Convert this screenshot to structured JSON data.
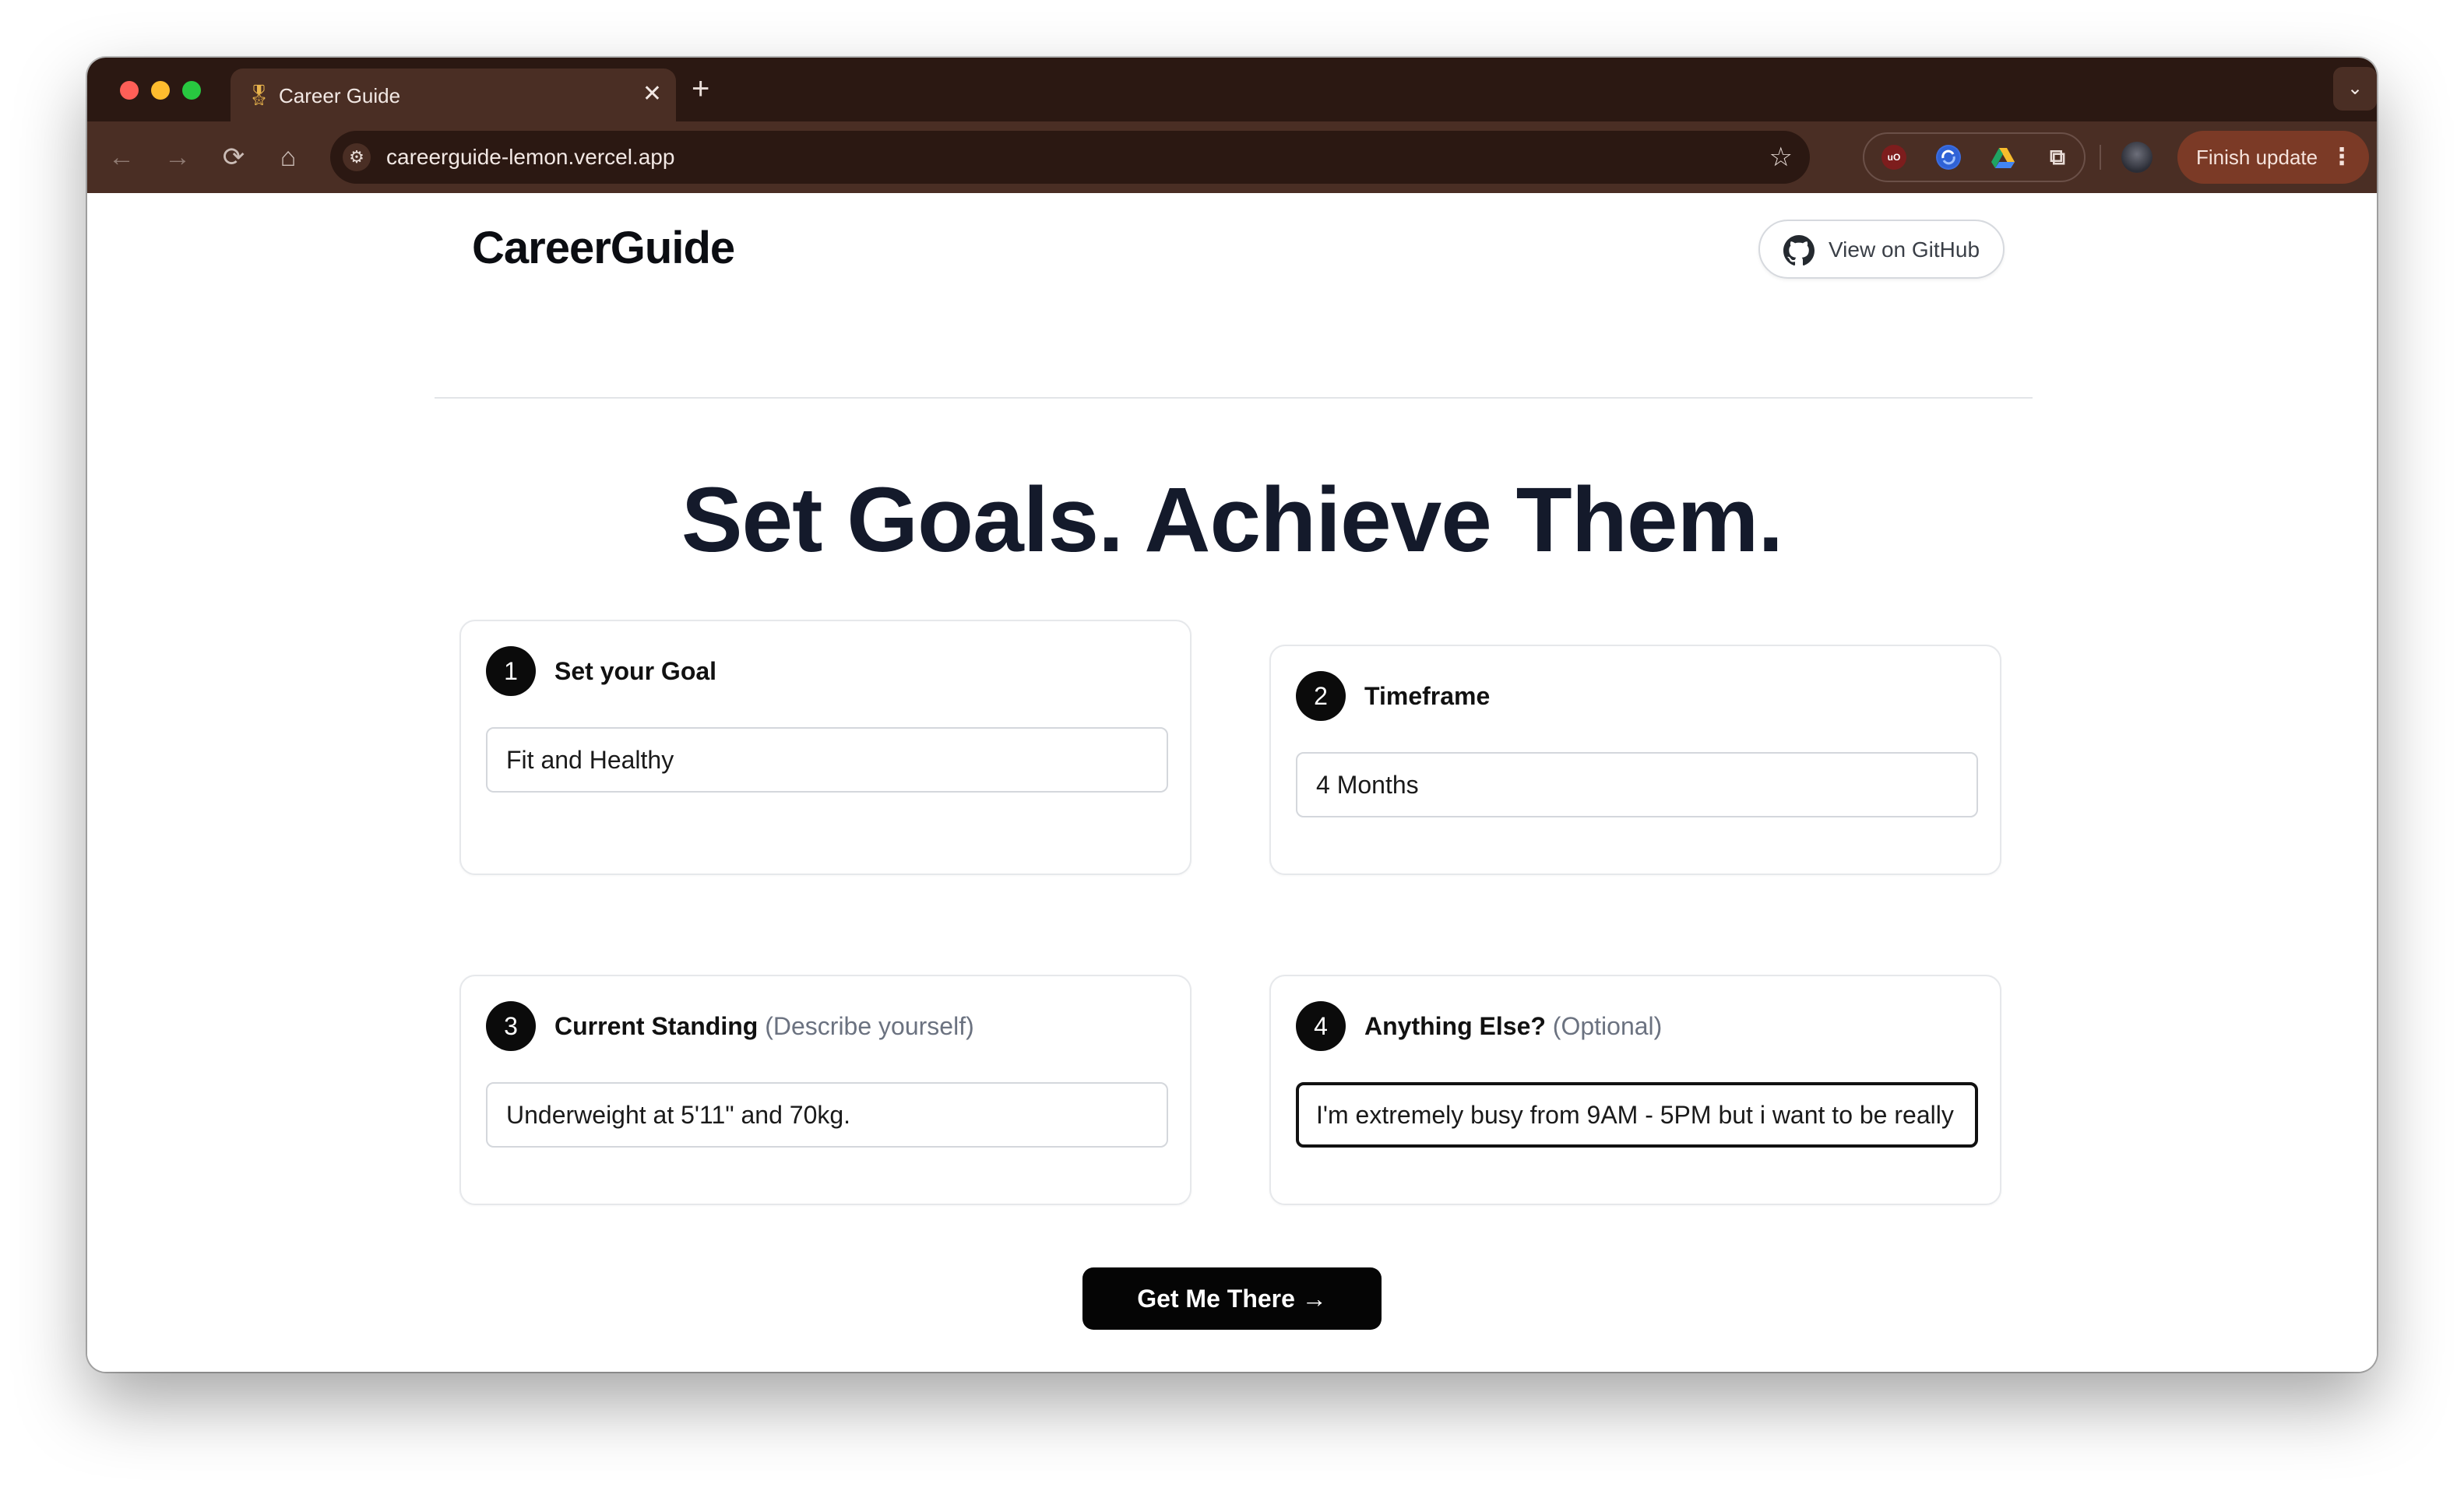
{
  "browser": {
    "tab": {
      "title": "Career Guide",
      "favicon_icon": "medal-icon",
      "favicon_glyph": "🎖",
      "close_glyph": "✕"
    },
    "new_tab_glyph": "+",
    "tab_list_glyph": "⌄",
    "nav": {
      "back_glyph": "←",
      "forward_glyph": "→",
      "reload_glyph": "⟳",
      "home_glyph": "⌂"
    },
    "url": "careerguide-lemon.vercel.app",
    "site_info_glyph": "⚙",
    "bookmark_glyph": "☆",
    "extensions": {
      "ublock_label": "uO",
      "puzzle_glyph": "⧉"
    },
    "update_button": {
      "label": "Finish update",
      "menu_glyph": "⋮"
    }
  },
  "header": {
    "brand": "CareerGuide",
    "github_button": {
      "label": "View on GitHub",
      "icon": "github-icon"
    }
  },
  "hero": {
    "title": "Set Goals. Achieve Them."
  },
  "steps": [
    {
      "number": "1",
      "label": "Set your Goal",
      "hint": "",
      "value": "Fit and Healthy"
    },
    {
      "number": "2",
      "label": "Timeframe",
      "hint": "",
      "value": "4 Months"
    },
    {
      "number": "3",
      "label": "Current Standing",
      "hint": " (Describe yourself)",
      "value": "Underweight at 5'11\" and 70kg."
    },
    {
      "number": "4",
      "label": "Anything Else?",
      "hint": " (Optional)",
      "value": "I'm extremely busy from 9AM - 5PM but i want to be really"
    }
  ],
  "cta": {
    "label": "Get Me There →"
  },
  "colors": {
    "tab_strip": "#2b1812",
    "toolbar": "#4a2e24",
    "update_button": "#7b3a26",
    "hero_text": "#141a2b",
    "cta_bg": "#050505"
  }
}
